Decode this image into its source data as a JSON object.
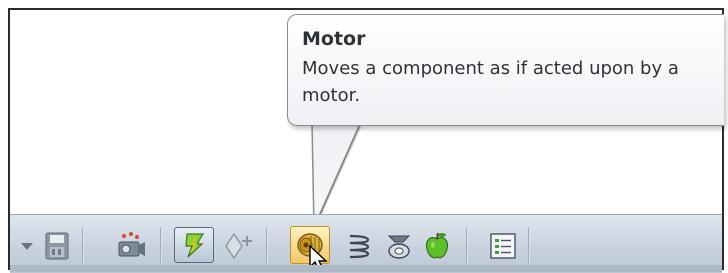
{
  "tooltip": {
    "title": "Motor",
    "description": "Moves a component as if acted upon by a motor."
  },
  "toolbar": {
    "items": [
      {
        "icon": "dropdown-arrow-icon"
      },
      {
        "icon": "save-animation-icon"
      },
      {
        "icon": "animation-wizard-icon"
      },
      {
        "icon": "autokey-icon",
        "state": "pressed"
      },
      {
        "icon": "add-update-key-icon"
      },
      {
        "icon": "motor-icon",
        "state": "hover"
      },
      {
        "icon": "spring-icon"
      },
      {
        "icon": "contact-icon"
      },
      {
        "icon": "gravity-icon"
      },
      {
        "icon": "results-and-plots-icon"
      }
    ]
  },
  "colors": {
    "toolbar": "#c9d3de",
    "tooltip_border": "#8c8c8c",
    "tooltip_text": "#2e3338",
    "hover_highlight": "#f3c76a"
  }
}
